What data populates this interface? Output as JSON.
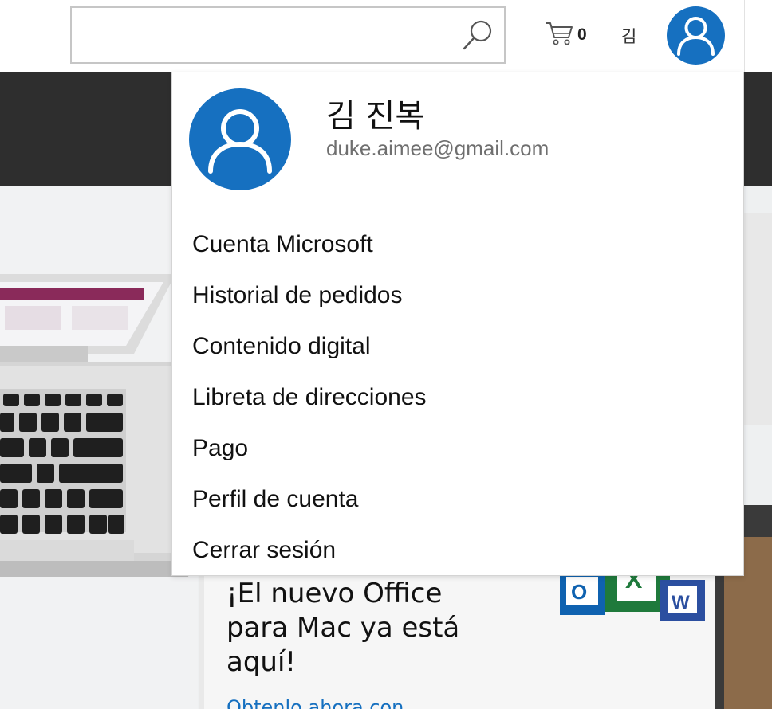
{
  "header": {
    "search": {
      "value": "",
      "placeholder": ""
    },
    "cart": {
      "count": "0"
    },
    "account": {
      "initial": "김"
    }
  },
  "dropdown": {
    "user": {
      "name": "김 진복",
      "email": "duke.aimee@gmail.com"
    },
    "menu": [
      {
        "label": "Cuenta Microsoft"
      },
      {
        "label": "Historial de pedidos"
      },
      {
        "label": "Contenido digital"
      },
      {
        "label": "Libreta de direcciones"
      },
      {
        "label": "Pago"
      },
      {
        "label": "Perfil de cuenta"
      },
      {
        "label": "Cerrar sesión"
      }
    ]
  },
  "promo": {
    "headline": "¡El nuevo Office para Mac ya está aquí!",
    "cta": "Obtenlo ahora con"
  },
  "colors": {
    "accent": "#1670c0",
    "dark_band": "#2e2e2e",
    "muted_text": "#6f6f6f"
  },
  "icons": [
    "search-icon",
    "cart-icon",
    "avatar-icon"
  ]
}
